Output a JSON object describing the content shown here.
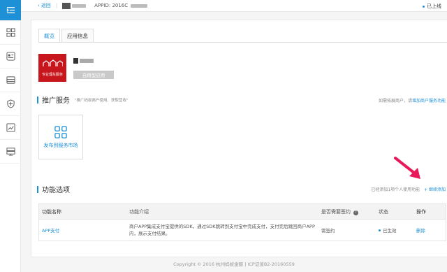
{
  "topbar": {
    "back_label": "返回",
    "appid_label": "APPID: 2016C",
    "status": "已上线"
  },
  "tabs": [
    {
      "label": "概览"
    },
    {
      "label": "应用信息"
    }
  ],
  "app": {
    "logo_text": "专业理车服务",
    "type_badge": "自用型应用"
  },
  "promo_section": {
    "title": "推广服务",
    "subtitle": "\"推广蚂蚁商户使用、获取营收\"",
    "right_note_prefix": "如需拓展商户，请",
    "right_note_link": "增加商户服务功能",
    "card_label": "发布到服务市场"
  },
  "features_section": {
    "title": "功能选项",
    "right_note": "已经添加1项个人使用功能",
    "add_link": "+ 继续添加"
  },
  "table": {
    "headers": [
      "功能名称",
      "功能介绍",
      "是否需要签约",
      "状态",
      "操作"
    ],
    "rows": [
      {
        "name": "APP支付",
        "intro": "商户APP集成支付宝提供的SDK，通过SDK跳转到支付宝中完成支付，支付完后跳回商户APP内，展示支付结果。",
        "sign": "需签约",
        "status": "已生效",
        "action": "删除"
      }
    ]
  },
  "footer": "Copyright © 2016 杭州蚂蚁金服 | ICP证浙B2-20160559",
  "colors": {
    "accent": "#1e90d6",
    "logo_red": "#c8161d",
    "arrow": "#e8185a"
  }
}
